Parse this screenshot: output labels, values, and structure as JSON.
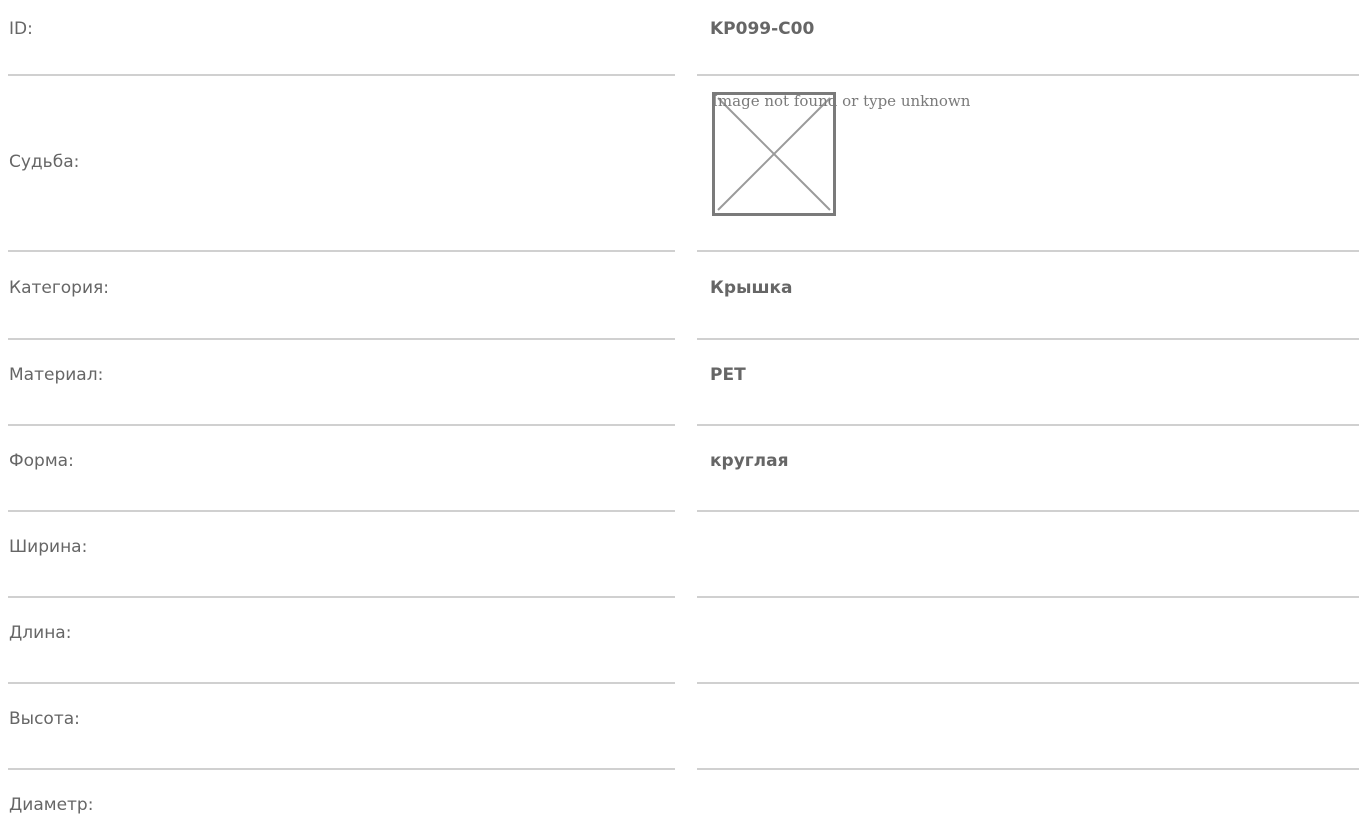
{
  "rows": [
    {
      "label": "ID:",
      "value": "KP099-C00"
    },
    {
      "label": "Судьба:",
      "value": "",
      "image_alt": "Image not found or type unknown",
      "image_icon": "broken-image-icon"
    },
    {
      "label": "Категория:",
      "value": "Крышка"
    },
    {
      "label": "Материал:",
      "value": "PET"
    },
    {
      "label": "Форма:",
      "value": "круглая"
    },
    {
      "label": "Ширина:",
      "value": ""
    },
    {
      "label": "Длина:",
      "value": ""
    },
    {
      "label": "Высота:",
      "value": ""
    },
    {
      "label": "Диаметр:",
      "value": ""
    }
  ]
}
